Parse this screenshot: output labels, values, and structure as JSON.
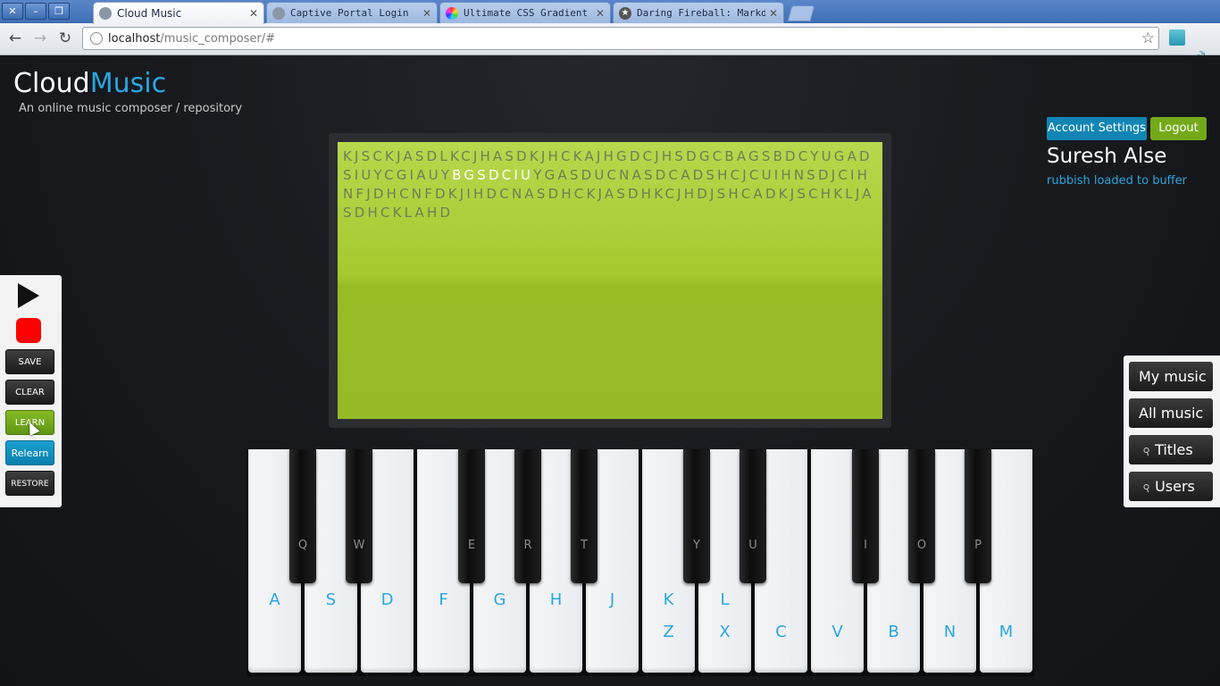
{
  "browser": {
    "tabs": [
      {
        "title": "Cloud Music",
        "active": true,
        "icon": "globe-icon"
      },
      {
        "title": "Captive Portal Login",
        "active": false,
        "icon": "globe-icon"
      },
      {
        "title": "Ultimate CSS Gradient Ge",
        "active": false,
        "icon": "color-wheel-icon"
      },
      {
        "title": "Daring Fireball: Markdow",
        "active": false,
        "icon": "star-icon"
      }
    ],
    "url_host": "localhost",
    "url_path": "/music_composer/#"
  },
  "brand": {
    "name_part1": "Cloud",
    "name_part2": "Music",
    "tagline": "An online music composer / repository"
  },
  "account": {
    "settings_label": "Account Settings",
    "logout_label": "Logout",
    "user_name": "Suresh Alse",
    "status": "rubbish loaded to buffer"
  },
  "composer": {
    "notes_before": "KJSCKJASDLKCJHASDKJHCKAJHGDCJHSDGCBAGSBDCYUGADSIUYCGIAUY",
    "notes_highlight": "BGSDCIU",
    "notes_after": "YGASDUCNASDCADSHCJCUIHNSDJCIHNFJDHCNFDKJIHDCNASDHCKJASDHKCJHDJSHCADKJSCHKLJASDHCKLAHD"
  },
  "controls": {
    "save": "SAVE",
    "clear": "CLEAR",
    "learn": "LEARN",
    "relearn": "Relearn",
    "restore": "RESTORE"
  },
  "nav": {
    "my_music": "My music",
    "all_music": "All music",
    "titles": "Titles",
    "users": "Users"
  },
  "keyboard": {
    "white_keys": [
      {
        "upper": "",
        "lower": "A"
      },
      {
        "upper": "",
        "lower": "S"
      },
      {
        "upper": "",
        "lower": "D"
      },
      {
        "upper": "",
        "lower": "F"
      },
      {
        "upper": "",
        "lower": "G"
      },
      {
        "upper": "",
        "lower": "H"
      },
      {
        "upper": "",
        "lower": "J"
      },
      {
        "upper": "K",
        "lower": "Z"
      },
      {
        "upper": "L",
        "lower": "X"
      },
      {
        "upper": "",
        "lower": "C"
      },
      {
        "upper": "",
        "lower": "V"
      },
      {
        "upper": "",
        "lower": "B"
      },
      {
        "upper": "",
        "lower": "N"
      },
      {
        "upper": "",
        "lower": "M"
      }
    ],
    "black_keys": [
      "Q",
      "W",
      "E",
      "R",
      "T",
      "Y",
      "U",
      "I",
      "O",
      "P"
    ]
  },
  "colors": {
    "accent": "#29a7e1",
    "screen_green": "#a4ca2e",
    "logout_green": "#74aa1a",
    "settings_blue": "#1185b3",
    "record_red": "#ff0000"
  }
}
